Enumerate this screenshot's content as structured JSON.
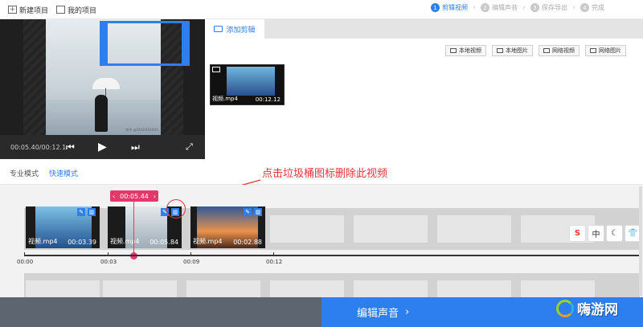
{
  "topbar": {
    "new_project": "新建项目",
    "my_projects": "我的项目",
    "steps": [
      {
        "num": "1",
        "label": "剪辑视频"
      },
      {
        "num": "2",
        "label": "编辑声音"
      },
      {
        "num": "3",
        "label": "保存导出"
      },
      {
        "num": "4",
        "label": "完成"
      }
    ]
  },
  "player": {
    "time": "00:05.40/00:12.1",
    "watermark": "知乎 @XXXXXXXXXX"
  },
  "media": {
    "tab": "添加剪辑",
    "buttons": [
      "本地视频",
      "本地图片",
      "网络视频",
      "网络图片"
    ],
    "thumb_name": "视频.mp4",
    "thumb_duration": "00:12.12"
  },
  "modes": {
    "pro": "专业模式",
    "fast": "快速模式"
  },
  "annotation": "点击垃圾桶图标删除此视频",
  "timeline": {
    "playhead_time": "00:05.44",
    "clips": [
      {
        "name": "视频.mp4",
        "duration": "00:03.39"
      },
      {
        "name": "视频.mp4",
        "duration": "00:05.84"
      },
      {
        "name": "视频.mp4",
        "duration": "00:02.88"
      }
    ],
    "ticks": [
      "00:00",
      "00:03",
      "00:09",
      "00:12"
    ]
  },
  "ime": [
    "S",
    "中",
    "☾",
    "👕"
  ],
  "bottom": {
    "next_label": "编辑声音",
    "logo_text": "嗨游网"
  },
  "colors": {
    "accent": "#2d7ff0",
    "playhead": "#e2396a",
    "annotation": "#e8343c"
  }
}
